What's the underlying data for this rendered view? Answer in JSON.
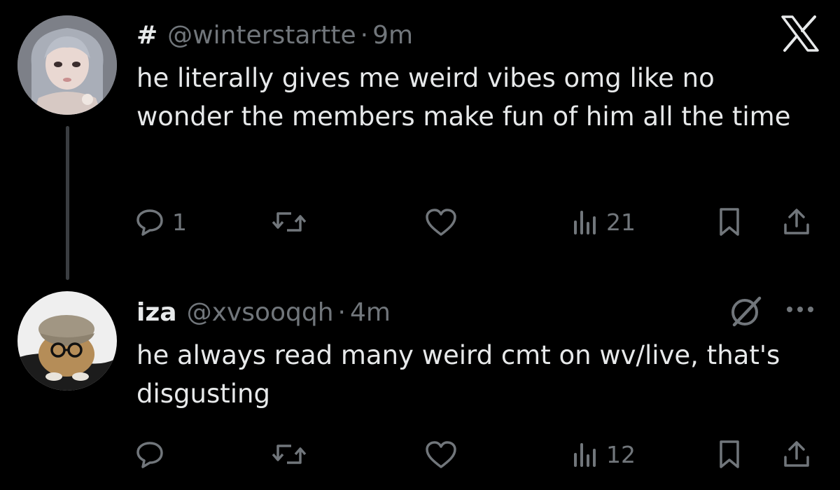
{
  "tweets": [
    {
      "display_name": "#",
      "handle": "@winterstartte",
      "separator": "·",
      "time": "9m",
      "text": "he literally gives me weird vibes omg like no wonder the members make fun of him all the time",
      "reply_count": "1",
      "retweet_count": "",
      "like_count": "",
      "view_count": "21",
      "header_icon": "x-logo-icon"
    },
    {
      "display_name": "iza",
      "handle": "@xvsooqqh",
      "separator": "·",
      "time": "4m",
      "text": "he always read many weird cmt on wv/live, that's disgusting",
      "reply_count": "",
      "retweet_count": "",
      "like_count": "",
      "view_count": "12",
      "header_icons": [
        "grok-icon",
        "more-icon"
      ]
    }
  ],
  "colors": {
    "background": "#000000",
    "text_primary": "#e7e9ea",
    "text_secondary": "#71767b",
    "thread_line": "#3a3d41"
  }
}
